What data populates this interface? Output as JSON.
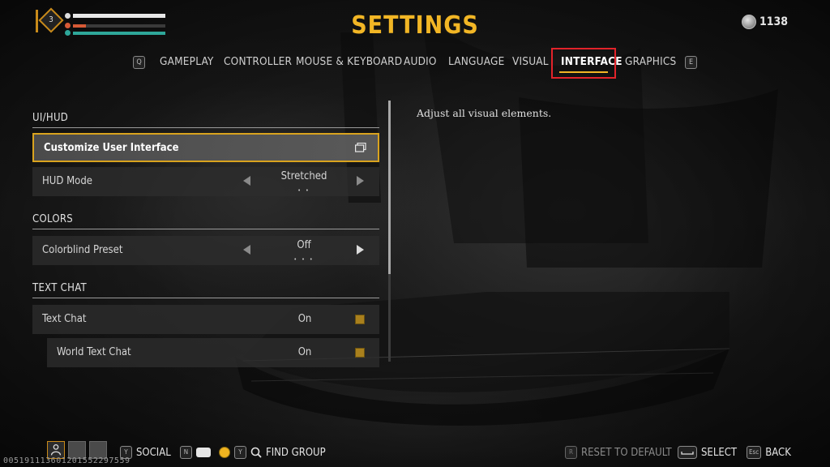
{
  "player": {
    "level": "3"
  },
  "title": "SETTINGS",
  "currency": {
    "icon": "silver-coin-icon",
    "value": "1138"
  },
  "tabs": {
    "prev_key": "Q",
    "next_key": "E",
    "items": [
      {
        "label": "GAMEPLAY"
      },
      {
        "label": "CONTROLLER"
      },
      {
        "label": "MOUSE & KEYBOARD"
      },
      {
        "label": "AUDIO"
      },
      {
        "label": "LANGUAGE"
      },
      {
        "label": "VISUAL"
      },
      {
        "label": "INTERFACE",
        "active": true
      },
      {
        "label": "GRAPHICS"
      }
    ]
  },
  "sections": {
    "uihud": {
      "title": "UI/HUD"
    },
    "colors": {
      "title": "COLORS"
    },
    "text_chat": {
      "title": "TEXT CHAT"
    }
  },
  "settings": {
    "customize_ui": {
      "label": "Customize User Interface",
      "icon": "window-icon"
    },
    "hud_mode": {
      "label": "HUD Mode",
      "value": "Stretched",
      "dots": "• •"
    },
    "colorblind": {
      "label": "Colorblind Preset",
      "value": "Off",
      "dots": "• • •"
    },
    "text_chat": {
      "label": "Text Chat",
      "value": "On"
    },
    "world_text_chat": {
      "label": "World Text Chat",
      "value": "On"
    }
  },
  "description": "Adjust all visual elements.",
  "bottom": {
    "social_key": "Y",
    "social_label": "SOCIAL",
    "n_key": "N",
    "y_key": "Y",
    "find_group_label": "FIND GROUP",
    "reset_key": "R",
    "reset_label": "RESET TO DEFAULT",
    "select_label": "SELECT",
    "back_key": "Esc",
    "back_label": "BACK"
  },
  "build_id": "005191113601201552297559",
  "colors": {
    "accent": "#f2b625",
    "highlight_frame": "#e2232a",
    "checkbox": "#a9801d"
  }
}
